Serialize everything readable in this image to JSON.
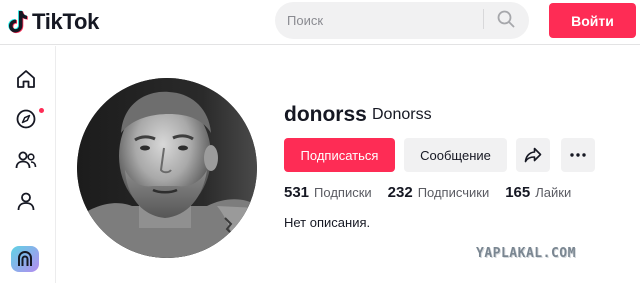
{
  "header": {
    "brand": "TikTok",
    "search": {
      "placeholder": "Поиск",
      "value": ""
    },
    "login_label": "Войти"
  },
  "sidebar": {
    "items": [
      {
        "icon": "home-icon"
      },
      {
        "icon": "explore-icon",
        "has_notification_dot": true
      },
      {
        "icon": "following-icon"
      },
      {
        "icon": "profile-icon"
      },
      {
        "icon": "app-icon"
      }
    ]
  },
  "profile": {
    "username": "donorss",
    "nickname": "Donorss",
    "follow_label": "Подписаться",
    "message_label": "Сообщение",
    "stats": [
      {
        "value": "531",
        "label": "Подписки"
      },
      {
        "value": "232",
        "label": "Подписчики"
      },
      {
        "value": "165",
        "label": "Лайки"
      }
    ],
    "bio": "Нет описания."
  },
  "colors": {
    "accent": "#fe2c55",
    "button_gray": "#f1f1f2",
    "text": "#161823"
  },
  "watermark": "YAPLAKAL.COM"
}
